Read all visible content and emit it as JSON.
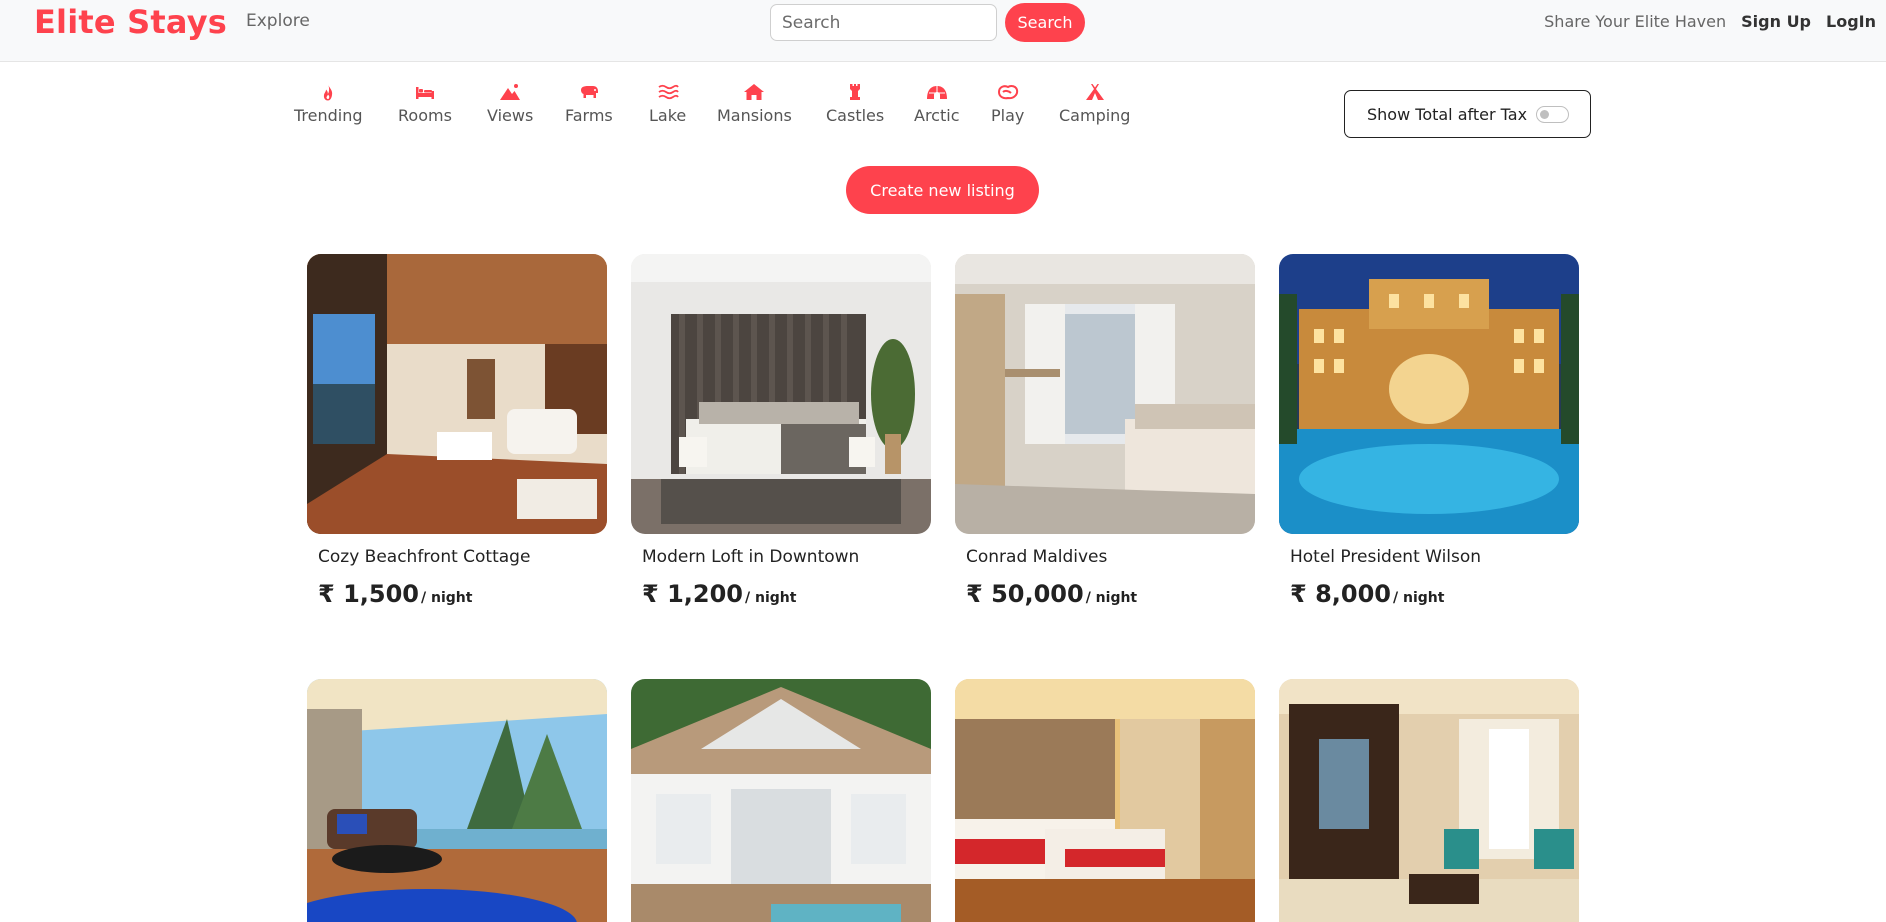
{
  "brand": "Elite Stays",
  "nav": {
    "explore": "Explore",
    "search_placeholder": "Search",
    "search_button": "Search",
    "share": "Share Your Elite Haven",
    "signup": "Sign Up",
    "login": "LogIn"
  },
  "filters": [
    {
      "label": "Trending",
      "icon": "fire-icon"
    },
    {
      "label": "Rooms",
      "icon": "bed-icon"
    },
    {
      "label": "Views",
      "icon": "mountain-icon"
    },
    {
      "label": "Farms",
      "icon": "cow-icon"
    },
    {
      "label": "Lake",
      "icon": "water-icon"
    },
    {
      "label": "Mansions",
      "icon": "house-icon"
    },
    {
      "label": "Castles",
      "icon": "castle-icon"
    },
    {
      "label": "Arctic",
      "icon": "igloo-icon"
    },
    {
      "label": "Play",
      "icon": "dragon-icon"
    },
    {
      "label": "Camping",
      "icon": "tent-icon"
    }
  ],
  "tax_toggle": {
    "label": "Show Total after Tax",
    "checked": false
  },
  "create_listing": "Create new listing",
  "currency": "₹",
  "per_night": "/ night",
  "listings": [
    {
      "title": "Cozy Beachfront Cottage",
      "price": "1,500"
    },
    {
      "title": "Modern Loft in Downtown",
      "price": "1,200"
    },
    {
      "title": "Conrad Maldives",
      "price": "50,000"
    },
    {
      "title": "Hotel President Wilson",
      "price": "8,000"
    },
    {
      "title": "",
      "price": ""
    },
    {
      "title": "",
      "price": ""
    },
    {
      "title": "",
      "price": ""
    },
    {
      "title": "",
      "price": ""
    }
  ],
  "colors": {
    "accent": "#fe424d",
    "text": "#222222",
    "muted": "#666666"
  }
}
